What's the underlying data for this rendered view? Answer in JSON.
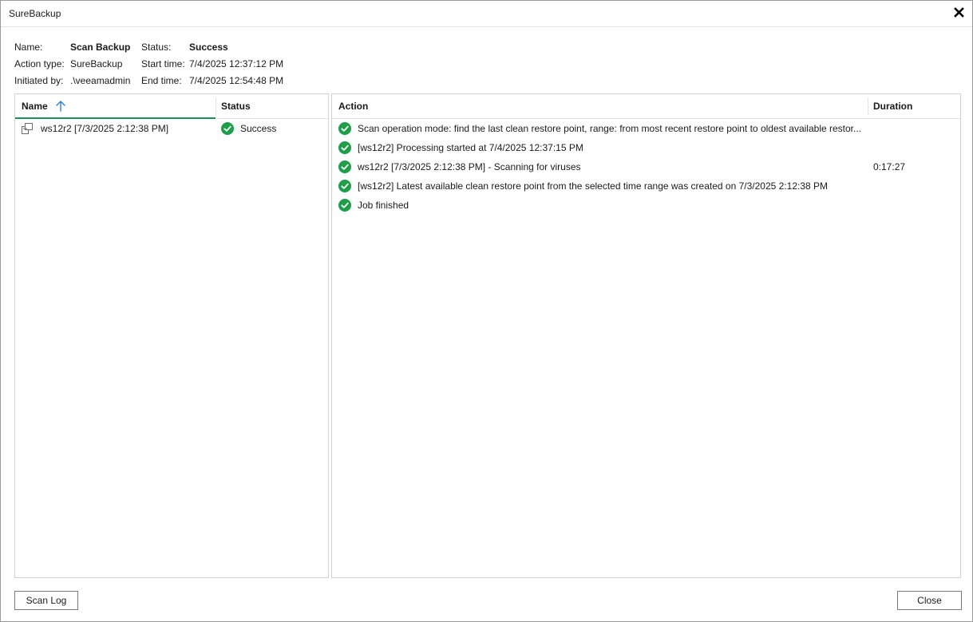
{
  "window": {
    "title": "SureBackup"
  },
  "info": {
    "name_label": "Name:",
    "name_value": "Scan Backup",
    "status_label": "Status:",
    "status_value": "Success",
    "action_type_label": "Action type:",
    "action_type_value": "SureBackup",
    "start_time_label": "Start time:",
    "start_time_value": "7/4/2025 12:37:12 PM",
    "initiated_by_label": "Initiated by:",
    "initiated_by_value": ".\\veeamadmin",
    "end_time_label": "End time:",
    "end_time_value": "7/4/2025 12:54:48 PM"
  },
  "objects_table": {
    "columns": {
      "name": "Name",
      "status": "Status"
    },
    "sort": {
      "column": "name",
      "direction": "ascending"
    },
    "rows": [
      {
        "name": "ws12r2 [7/3/2025 2:12:38 PM]",
        "status": "Success",
        "icon": "vm-icon"
      }
    ]
  },
  "actions_table": {
    "columns": {
      "action": "Action",
      "duration": "Duration"
    },
    "rows": [
      {
        "action": "Scan operation mode: find the last clean restore point, range: from most recent restore point to oldest available restor...",
        "duration": "",
        "icon": "success-icon"
      },
      {
        "action": "[ws12r2] Processing started at 7/4/2025 12:37:15 PM",
        "duration": "",
        "icon": "success-icon"
      },
      {
        "action": "ws12r2 [7/3/2025 2:12:38 PM] - Scanning for viruses",
        "duration": "0:17:27",
        "icon": "success-icon"
      },
      {
        "action": "[ws12r2] Latest available clean restore point from the selected time range was created on 7/3/2025 2:12:38 PM",
        "duration": "",
        "icon": "success-icon"
      },
      {
        "action": "Job finished",
        "duration": "",
        "icon": "success-icon"
      }
    ]
  },
  "buttons": {
    "scan_log": "Scan Log",
    "close": "Close"
  },
  "colors": {
    "success": "#1e9e4a",
    "sort_accent": "#1f8a5a",
    "sort_arrow": "#2a7fd4"
  }
}
